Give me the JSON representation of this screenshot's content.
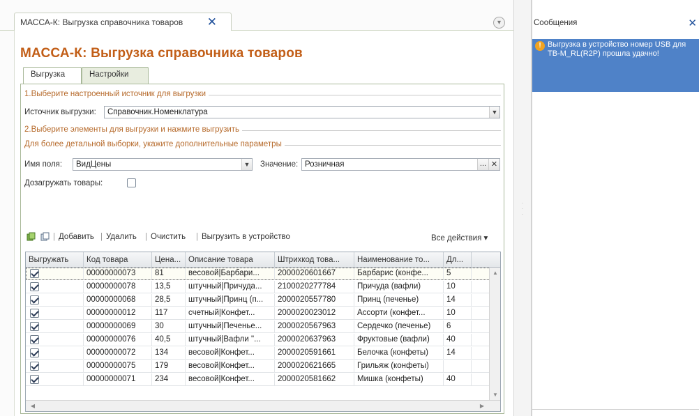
{
  "window": {
    "tab_title": "МАССА-К: Выгрузка справочника товаров",
    "close_glyph": "✕",
    "collapse_glyph": "▾"
  },
  "form": {
    "title": "МАССА-К: Выгрузка справочника товаров",
    "tabs": [
      {
        "label": "Выгрузка",
        "active": true
      },
      {
        "label": "Настройки",
        "active": false
      }
    ],
    "section1_label": "1.Выберите настроенный источник для выгрузки",
    "source_label": "Источник выгрузки:",
    "source_value": "Справочник.Номенклатура",
    "section2_label": "2.Выберите элементы для выгрузки и нажмите выгрузить",
    "section3_label": "Для более детальной выборки, укажите дополнительные параметры",
    "field_name_label": "Имя поля:",
    "field_name_value": "ВидЦены",
    "value_label": "Значение:",
    "value_value": "Розничная",
    "value_select_glyph": "...",
    "value_clear_glyph": "✕",
    "append_label": "Дозагружать товары:",
    "append_checked": false
  },
  "toolbar": {
    "add": "Добавить",
    "delete": "Удалить",
    "clear": "Очистить",
    "upload": "Выгрузить в устройство",
    "all_actions": "Все действия ▾",
    "separator": "|"
  },
  "grid": {
    "columns": [
      "Выгружать",
      "Код товара",
      "Цена...",
      "Описание товара",
      "Штрихкод това...",
      "Наименование то...",
      "Дл..."
    ],
    "rows": [
      {
        "check": true,
        "code": "00000000073",
        "price": "81",
        "desc": "весовой|Барбари...",
        "barcode": "2000020601667",
        "name": "Барбарис (конфе...",
        "len": "5"
      },
      {
        "check": true,
        "code": "00000000078",
        "price": "13,5",
        "desc": "штучный|Причуда...",
        "barcode": "2100020277784",
        "name": "Причуда (вафли)",
        "len": "10"
      },
      {
        "check": true,
        "code": "00000000068",
        "price": "28,5",
        "desc": "штучный|Принц (п...",
        "barcode": "2000020557780",
        "name": "Принц (печенье)",
        "len": "14"
      },
      {
        "check": true,
        "code": "00000000012",
        "price": "117",
        "desc": "счетный|Конфет...",
        "barcode": "2000020023012",
        "name": "Ассорти (конфет...",
        "len": "10"
      },
      {
        "check": true,
        "code": "00000000069",
        "price": "30",
        "desc": "штучный|Печенье...",
        "barcode": "2000020567963",
        "name": "Сердечко (печенье)",
        "len": "6"
      },
      {
        "check": true,
        "code": "00000000076",
        "price": "40,5",
        "desc": "штучный|Вафли \"...",
        "barcode": "2000020637963",
        "name": "Фруктовые (вафли)",
        "len": "40"
      },
      {
        "check": true,
        "code": "00000000072",
        "price": "134",
        "desc": "весовой|Конфет...",
        "barcode": "2000020591661",
        "name": "Белочка (конфеты)",
        "len": "14"
      },
      {
        "check": true,
        "code": "00000000075",
        "price": "179",
        "desc": "весовой|Конфет...",
        "barcode": "2000020621665",
        "name": "Грильяж (конфеты)",
        "len": ""
      },
      {
        "check": true,
        "code": "00000000071",
        "price": "234",
        "desc": "весовой|Конфет...",
        "barcode": "2000020581662",
        "name": "Мишка (конфеты)",
        "len": "40"
      }
    ]
  },
  "messages": {
    "title": "Сообщения",
    "close_glyph": "✕",
    "items": [
      {
        "icon": "warning-icon",
        "text": "Выгрузка в устройство номер USB для ТВ-М_RL(R2P) прошла удачно!"
      }
    ]
  },
  "colors": {
    "title_orange": "#c25e17",
    "section_orange": "#b66a2b",
    "message_highlight": "#4f82c8",
    "close_blue": "#1e4f9a"
  }
}
